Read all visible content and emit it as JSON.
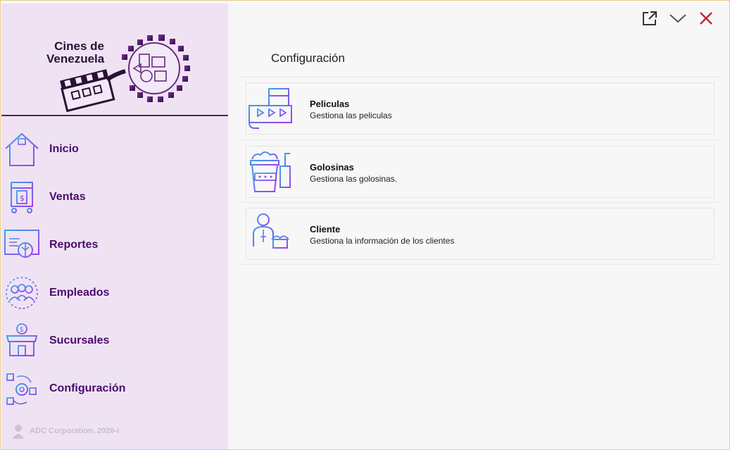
{
  "app": {
    "logo_text_line1": "Cines de",
    "logo_text_line2": "Venezuela",
    "footer_text": "ADC Corporation. 2020-I"
  },
  "sidebar": {
    "items": [
      {
        "label": "Inicio",
        "icon": "home-icon"
      },
      {
        "label": "Ventas",
        "icon": "cart-icon"
      },
      {
        "label": "Reportes",
        "icon": "report-icon"
      },
      {
        "label": "Empleados",
        "icon": "employees-icon"
      },
      {
        "label": "Sucursales",
        "icon": "store-icon"
      },
      {
        "label": "Configuración",
        "icon": "settings-icon"
      }
    ]
  },
  "main": {
    "title": "Configuración",
    "cards": [
      {
        "title": "Peliculas",
        "description": "Gestiona las peliculas",
        "icon": "film-icon"
      },
      {
        "title": "Golosinas",
        "description": "Gestiona las golosinas.",
        "icon": "snacks-icon"
      },
      {
        "title": "Cliente",
        "description": "Gestiona la información de los clientes",
        "icon": "client-icon"
      }
    ]
  },
  "colors": {
    "sidebar_bg": "#efe3f3",
    "nav_text": "#4b0a6e",
    "accent_purple": "#8a3ff0",
    "close_red": "#c0272d"
  }
}
